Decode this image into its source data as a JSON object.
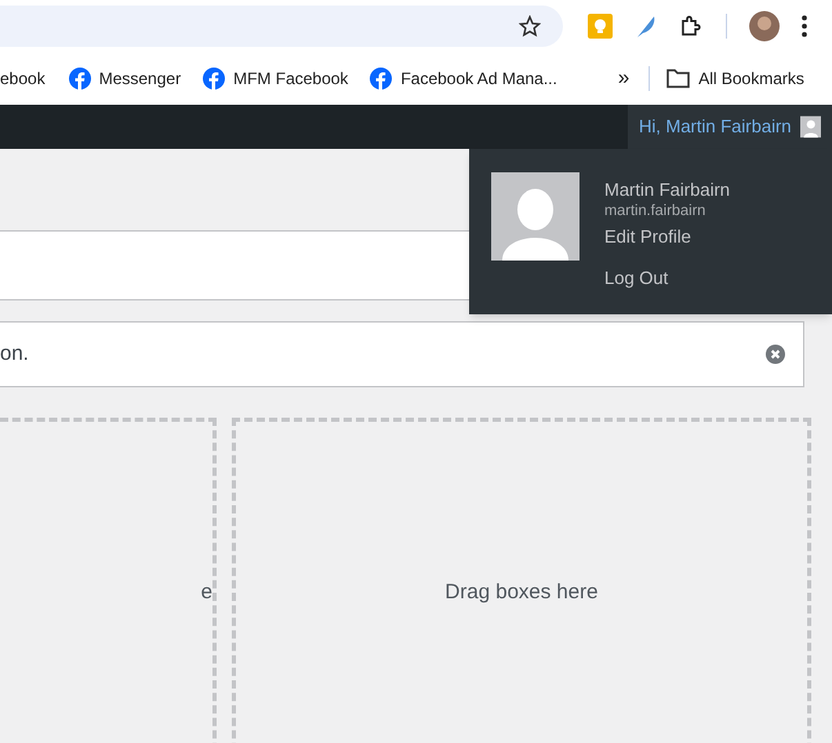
{
  "bookmarks": [
    {
      "label": "ebook",
      "icon": false
    },
    {
      "label": "Messenger",
      "icon": true
    },
    {
      "label": "MFM Facebook",
      "icon": true
    },
    {
      "label": "Facebook Ad Mana...",
      "icon": true
    }
  ],
  "overflow": "»",
  "all_bookmarks": "All Bookmarks",
  "admin_bar": {
    "greeting": "Hi, Martin Fairbairn"
  },
  "user_menu": {
    "name": "Martin Fairbairn",
    "username": "martin.fairbairn",
    "links": [
      "Edit Profile",
      "Log Out"
    ]
  },
  "notice": {
    "text": "on."
  },
  "drop_zones": [
    {
      "label": "e"
    },
    {
      "label": "Drag boxes here"
    }
  ]
}
